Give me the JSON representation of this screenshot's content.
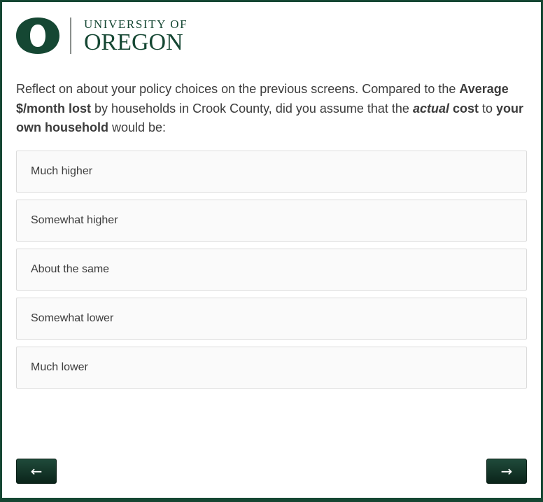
{
  "header": {
    "logo_icon": "university-of-oregon-o-logo",
    "wordmark_top": "UNIVERSITY OF",
    "wordmark_bottom": "OREGON",
    "brand_color": "#154733"
  },
  "question": {
    "part1": "Reflect on about your policy choices on the previous screens. Compared to the ",
    "bold1": "Average $/month lost",
    "part2": " by households in Crook County, did you assume that the ",
    "italic_bold": "actual",
    "part3": " ",
    "bold2": "cost",
    "part4": " to ",
    "bold3": "your own household",
    "part5": " would be:"
  },
  "options": [
    {
      "label": "Much higher"
    },
    {
      "label": "Somewhat higher"
    },
    {
      "label": "About the same"
    },
    {
      "label": "Somewhat lower"
    },
    {
      "label": "Much lower"
    }
  ],
  "navigation": {
    "back_label": "←",
    "next_label": "→",
    "back_icon": "left-arrow-icon",
    "next_icon": "right-arrow-icon"
  }
}
